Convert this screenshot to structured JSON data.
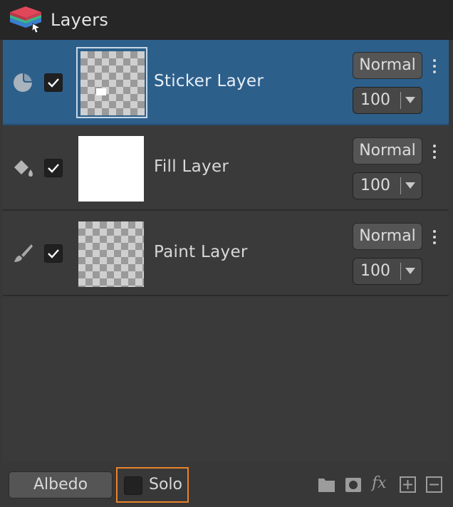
{
  "window": {
    "title": "Layers"
  },
  "layers": [
    {
      "name": "Sticker Layer",
      "type_icon": "sticker-icon",
      "visible": true,
      "selected": true,
      "thumbnail": "checkerboard",
      "blend_mode": "Normal",
      "opacity": "100"
    },
    {
      "name": "Fill Layer",
      "type_icon": "paint-bucket-icon",
      "visible": true,
      "selected": false,
      "thumbnail": "white",
      "blend_mode": "Normal",
      "opacity": "100"
    },
    {
      "name": "Paint Layer",
      "type_icon": "brush-icon",
      "visible": true,
      "selected": false,
      "thumbnail": "checkerboard",
      "blend_mode": "Normal",
      "opacity": "100"
    }
  ],
  "footer": {
    "channel_button": "Albedo",
    "solo_label": "Solo",
    "solo_checked": false,
    "actions": [
      {
        "icon": "folder-icon"
      },
      {
        "icon": "mask-icon"
      },
      {
        "icon": "fx-icon",
        "label": "fx"
      },
      {
        "icon": "add-layer-icon"
      },
      {
        "icon": "remove-layer-icon"
      }
    ]
  },
  "colors": {
    "selection": "#2d5f8b",
    "highlight": "#e8832a",
    "logo_top": "#e0485a",
    "logo_mid": "#3bb58a",
    "logo_bottom": "#3a7fd0"
  }
}
